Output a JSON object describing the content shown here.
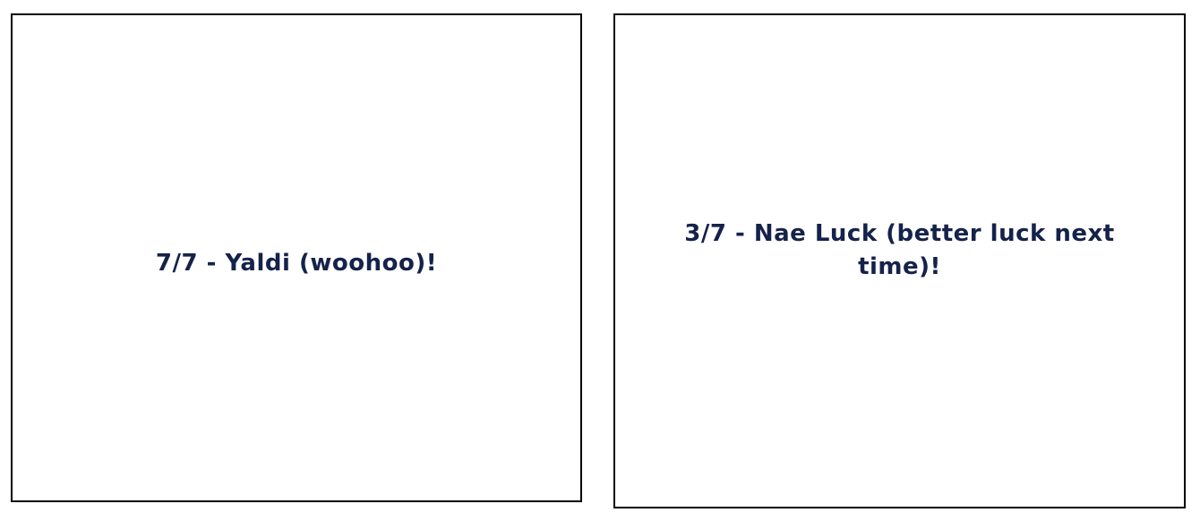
{
  "results": [
    {
      "text": "7/7 - Yaldi (woohoo)!"
    },
    {
      "text": "3/7 - Nae Luck (better luck next time)!"
    }
  ],
  "colors": {
    "text": "#15224a",
    "border": "#000000",
    "background": "#ffffff"
  }
}
